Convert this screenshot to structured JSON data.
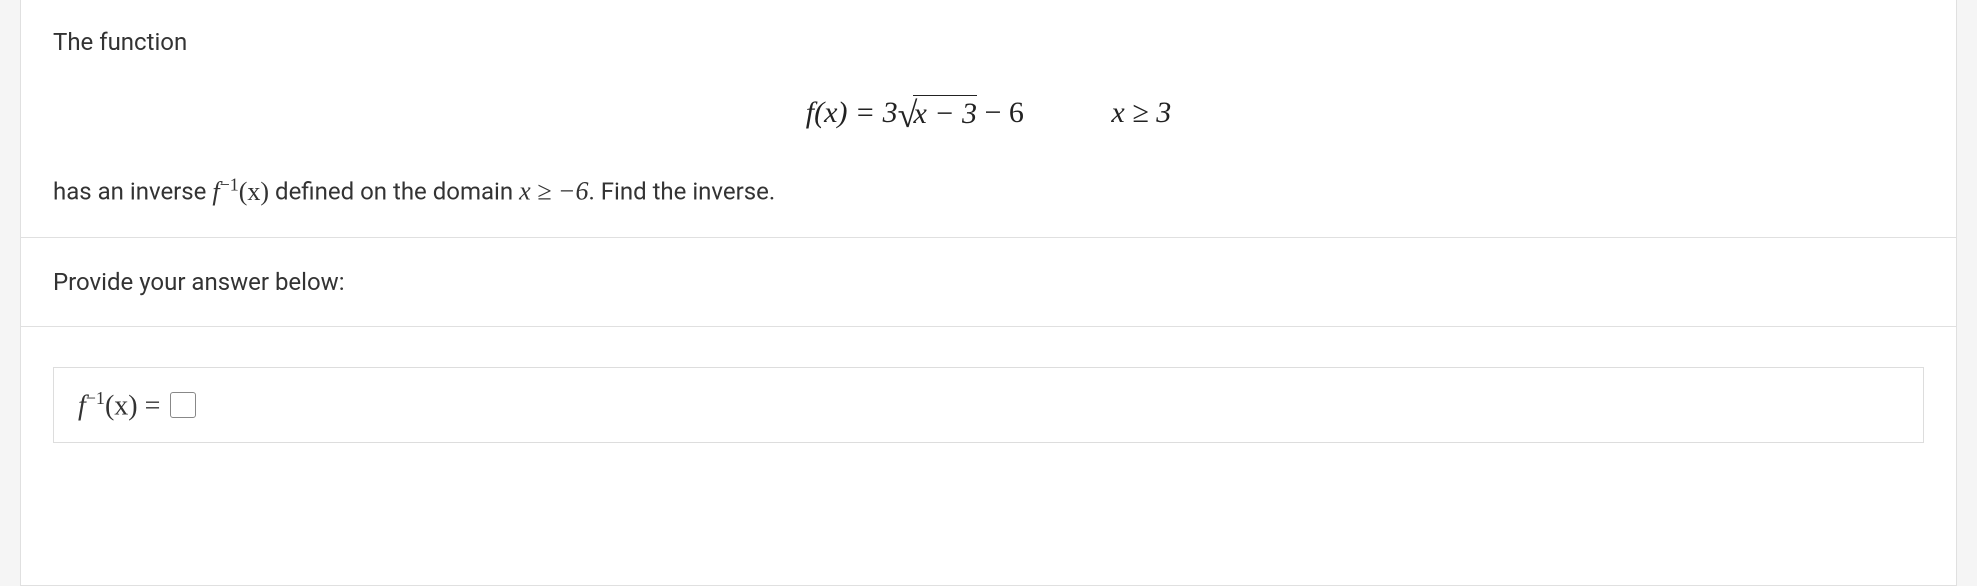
{
  "question": {
    "intro": "The function",
    "equation": {
      "lhs": "f(x) = 3",
      "sqrt_content": "x − 3",
      "after_sqrt": " − 6",
      "domain": "x ≥ 3"
    },
    "inverse_text_prefix": "has an inverse ",
    "inverse_notation": "f",
    "inverse_superscript": "−1",
    "inverse_arg": "(x)",
    "inverse_text_mid": " defined on the domain ",
    "inverse_domain": "x ≥ −6",
    "inverse_text_suffix": ". Find the inverse."
  },
  "answer_prompt": "Provide your answer below:",
  "answer_prefix": {
    "function": "f",
    "superscript": "−1",
    "arg": "(x)",
    "equals": " = "
  }
}
